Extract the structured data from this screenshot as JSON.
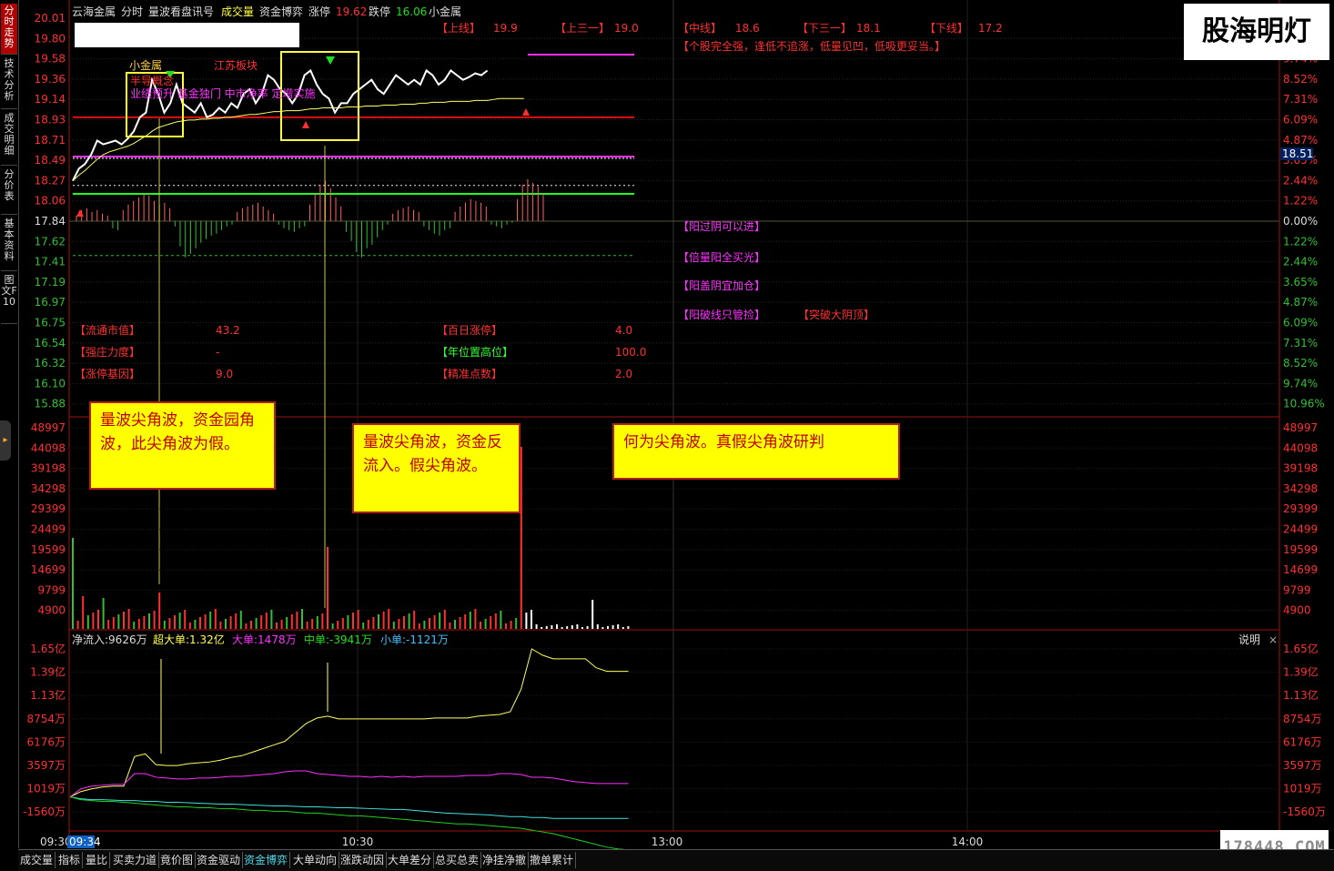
{
  "header": {
    "stock_name": "云海金属",
    "mode": "分时",
    "items": [
      "量波看盘讯号",
      "成交量",
      "资金博弈"
    ],
    "limit_up_label": "涨停",
    "limit_up_value": "19.62",
    "limit_down_label": "跌停",
    "limit_down_value": "16.06",
    "sector": "小金属"
  },
  "sidebar": {
    "tabs": [
      {
        "label": "分时走势",
        "active": true
      },
      {
        "label": "技术分析",
        "active": false
      },
      {
        "label": "成交明细",
        "active": false
      },
      {
        "label": "分价表",
        "active": false
      },
      {
        "label": "基本资料",
        "active": false
      },
      {
        "label": "图文F10",
        "active": false
      }
    ]
  },
  "price_axis": {
    "left": [
      "20.01",
      "19.80",
      "19.58",
      "19.36",
      "19.14",
      "18.93",
      "18.71",
      "18.49",
      "18.27",
      "18.06",
      "17.84",
      "17.62",
      "17.41",
      "17.19",
      "16.97",
      "16.75",
      "16.54",
      "16.32",
      "16.10",
      "15.88"
    ],
    "right": [
      "",
      "",
      "9.74%",
      "8.52%",
      "7.31%",
      "6.09%",
      "4.87%",
      "3.65%",
      "2.44%",
      "1.22%",
      "0.00%",
      "1.22%",
      "2.44%",
      "3.65%",
      "4.87%",
      "6.09%",
      "7.31%",
      "8.52%",
      "9.74%",
      "10.96%"
    ],
    "current_price": "18.51"
  },
  "volume_axis": [
    "48997",
    "44098",
    "39198",
    "34298",
    "29399",
    "24499",
    "19599",
    "14699",
    "9799",
    "4900"
  ],
  "flow_axis": [
    "1.65亿",
    "1.39亿",
    "1.13亿",
    "8754万",
    "6176万",
    "3597万",
    "1019万",
    "-1560万"
  ],
  "time_axis": {
    "start": "09:30",
    "cursor": "09:34",
    "t1": "10:30",
    "t2": "13:00",
    "t3": "14:00"
  },
  "levels": {
    "shangxian_label": "【上线】",
    "shangxian": "19.9",
    "shangsanyi_label": "【上三一】",
    "shangsanyi": "19.0",
    "zhongxian_label": "【中线】",
    "zhongxian": "18.6",
    "xiasanyi_label": "【下三一】",
    "xiasanyi": "18.1",
    "xiaxian_label": "【下线】",
    "xiaxian": "17.2"
  },
  "advice": "【个股完全强，逢低不追涨，低量见凹，低吸更妥当。】",
  "signals": [
    "【阳过阴可以进】",
    "【倍量阳全买光】",
    "【阳盖阴宜加仓】",
    "【阳破线只管捡】",
    "【突破大阴顶】"
  ],
  "stats": [
    {
      "label": "【流通市值】",
      "value": "43.2",
      "label_color": "#ff3030"
    },
    {
      "label": "【强庄力度】",
      "value": "-",
      "label_color": "#ff3030"
    },
    {
      "label": "【涨停基因】",
      "value": "9.0",
      "label_color": "#ff3030"
    },
    {
      "label": "【百日涨停】",
      "value": "4.0",
      "label_color": "#ff3030"
    },
    {
      "label": "【年位置高位】",
      "value": "100.0",
      "label_color": "#30ff30"
    },
    {
      "label": "【精准点数】",
      "value": "2.0",
      "label_color": "#ff3030"
    }
  ],
  "annotations": {
    "sector_tag": "小金属",
    "jiangsu": "江苏板块",
    "concept": "半导概念",
    "news": "业绩预升 基金独门 中市净率 定增实施"
  },
  "flow_header": {
    "net_label": "净流入:",
    "net_value": "9626万",
    "super_label": "超大单:",
    "super_value": "1.32亿",
    "large_label": "大单:",
    "large_value": "1478万",
    "medium_label": "中单:",
    "medium_value": "-3941万",
    "small_label": "小单:",
    "small_value": "-1121万",
    "help": "说明"
  },
  "notes": [
    "量波尖角波，资金园角波，此尖角波为假。",
    "量波尖角波，资金反流入。假尖角波。",
    "何为尖角波。真假尖角波研判"
  ],
  "watermark": "股海明灯",
  "watermark2": "178448.COM",
  "bottom_tabs": [
    {
      "label": "成交量",
      "active": false
    },
    {
      "label": "指标",
      "active": false
    },
    {
      "label": "量比",
      "active": false
    },
    {
      "label": "买卖力道",
      "active": false
    },
    {
      "label": "竟价图",
      "active": false
    },
    {
      "label": "资金驱动",
      "active": false
    },
    {
      "label": "资金博弈",
      "active": true
    },
    {
      "label": "大单动向",
      "active": false
    },
    {
      "label": "涨跌动因",
      "active": false
    },
    {
      "label": "大单差分",
      "active": false
    },
    {
      "label": "总买总卖",
      "active": false
    },
    {
      "label": "净挂净撤",
      "active": false
    },
    {
      "label": "撤单累计",
      "active": false
    }
  ],
  "colors": {
    "up": "#ff3030",
    "down": "#30c030",
    "price": "#ffffff",
    "avg": "#ffff66",
    "magenta": "#ff30ff",
    "cyan": "#40e0e0"
  },
  "chart_data": {
    "type": "line",
    "price": [
      18.27,
      18.4,
      18.45,
      18.55,
      18.7,
      18.66,
      18.68,
      18.7,
      18.66,
      18.72,
      18.8,
      18.95,
      19.0,
      19.35,
      19.2,
      19.0,
      19.1,
      19.3,
      19.1,
      19.05,
      19.0,
      19.1,
      18.95,
      18.98,
      19.05,
      19.0,
      19.1,
      19.05,
      19.2,
      19.25,
      19.1,
      19.2,
      19.4,
      19.35,
      19.25,
      19.2,
      19.1,
      19.2,
      19.4,
      19.45,
      19.3,
      19.2,
      19.15,
      19.0,
      19.1,
      19.1,
      19.2,
      19.25,
      19.3,
      19.35,
      19.25,
      19.2,
      19.3,
      19.4,
      19.35,
      19.3,
      19.35,
      19.3,
      19.45,
      19.4,
      19.3,
      19.35,
      19.45,
      19.4,
      19.35,
      19.38,
      19.42,
      19.4,
      19.45,
      19.62,
      19.62,
      19.62,
      19.62,
      19.62,
      19.62
    ],
    "avg": [
      18.27,
      18.33,
      18.38,
      18.44,
      18.5,
      18.55,
      18.58,
      18.6,
      18.62,
      18.64,
      18.67,
      18.71,
      18.75,
      18.8,
      18.84,
      18.86,
      18.88,
      18.9,
      18.91,
      18.92,
      18.92,
      18.93,
      18.93,
      18.94,
      18.94,
      18.95,
      18.95,
      18.96,
      18.97,
      18.98,
      18.98,
      18.99,
      19.0,
      19.01,
      19.01,
      19.02,
      19.02,
      19.02,
      19.03,
      19.04,
      19.04,
      19.05,
      19.05,
      19.05,
      19.05,
      19.06,
      19.06,
      19.06,
      19.07,
      19.07,
      19.07,
      19.08,
      19.08,
      19.08,
      19.09,
      19.09,
      19.09,
      19.1,
      19.1,
      19.11,
      19.11,
      19.11,
      19.12,
      19.12,
      19.12,
      19.12,
      19.13,
      19.13,
      19.13,
      19.14,
      19.15,
      19.15,
      19.15,
      19.15,
      19.15
    ],
    "flow_super": [
      0,
      600,
      900,
      1100,
      1200,
      1200,
      4500,
      4800,
      3600,
      3500,
      3500,
      3700,
      3800,
      3900,
      4100,
      4400,
      4600,
      5000,
      5400,
      5800,
      6200,
      7200,
      8200,
      8800,
      9000,
      8700,
      8700,
      8700,
      8700,
      8700,
      8700,
      8700,
      8700,
      8700,
      8800,
      8800,
      8800,
      8800,
      9000,
      9100,
      9200,
      9500,
      12000,
      16500,
      15800,
      15400,
      15400,
      15400,
      15400,
      14400,
      14000,
      14000,
      14000
    ],
    "flow_large": [
      0,
      900,
      1200,
      1300,
      1400,
      1400,
      2600,
      2600,
      2200,
      2100,
      2000,
      2000,
      2100,
      2100,
      2200,
      2300,
      2300,
      2400,
      2500,
      2600,
      2800,
      2900,
      2900,
      2600,
      2500,
      2400,
      2300,
      2300,
      2200,
      2300,
      2200,
      2300,
      2200,
      2300,
      2300,
      2300,
      2300,
      2400,
      2400,
      2400,
      2600,
      2600,
      2500,
      2200,
      2200,
      2100,
      1900,
      1700,
      1600,
      1500,
      1500,
      1500,
      1500
    ],
    "flow_small": [
      0,
      -200,
      -300,
      -300,
      -350,
      -400,
      -400,
      -500,
      -500,
      -600,
      -600,
      -650,
      -700,
      -750,
      -800,
      -800,
      -850,
      -900,
      -950,
      -1000,
      -1000,
      -1050,
      -1100,
      -1100,
      -1150,
      -1200,
      -1200,
      -1250,
      -1300,
      -1350,
      -1400,
      -1400,
      -1500,
      -1600,
      -1700,
      -1800,
      -1850,
      -1900,
      -1950,
      -2000,
      -2100,
      -2200,
      -2200,
      -2300,
      -2300,
      -2400,
      -2400,
      -2400,
      -2400,
      -2400,
      -2400,
      -2400,
      -2400
    ],
    "flow_medium": [
      0,
      -300,
      -400,
      -500,
      -500,
      -600,
      -700,
      -800,
      -900,
      -1000,
      -1100,
      -1100,
      -1200,
      -1200,
      -1300,
      -1300,
      -1400,
      -1500,
      -1500,
      -1600,
      -1600,
      -1700,
      -1800,
      -1800,
      -1900,
      -2000,
      -2100,
      -2100,
      -2200,
      -2300,
      -2400,
      -2500,
      -2600,
      -2700,
      -2800,
      -2900,
      -3000,
      -3000,
      -3100,
      -3200,
      -3300,
      -3400,
      -3500,
      -3700,
      -3900,
      -4100,
      -4400,
      -4700,
      -5000,
      -5300,
      -5600,
      -5800,
      -5900
    ]
  }
}
